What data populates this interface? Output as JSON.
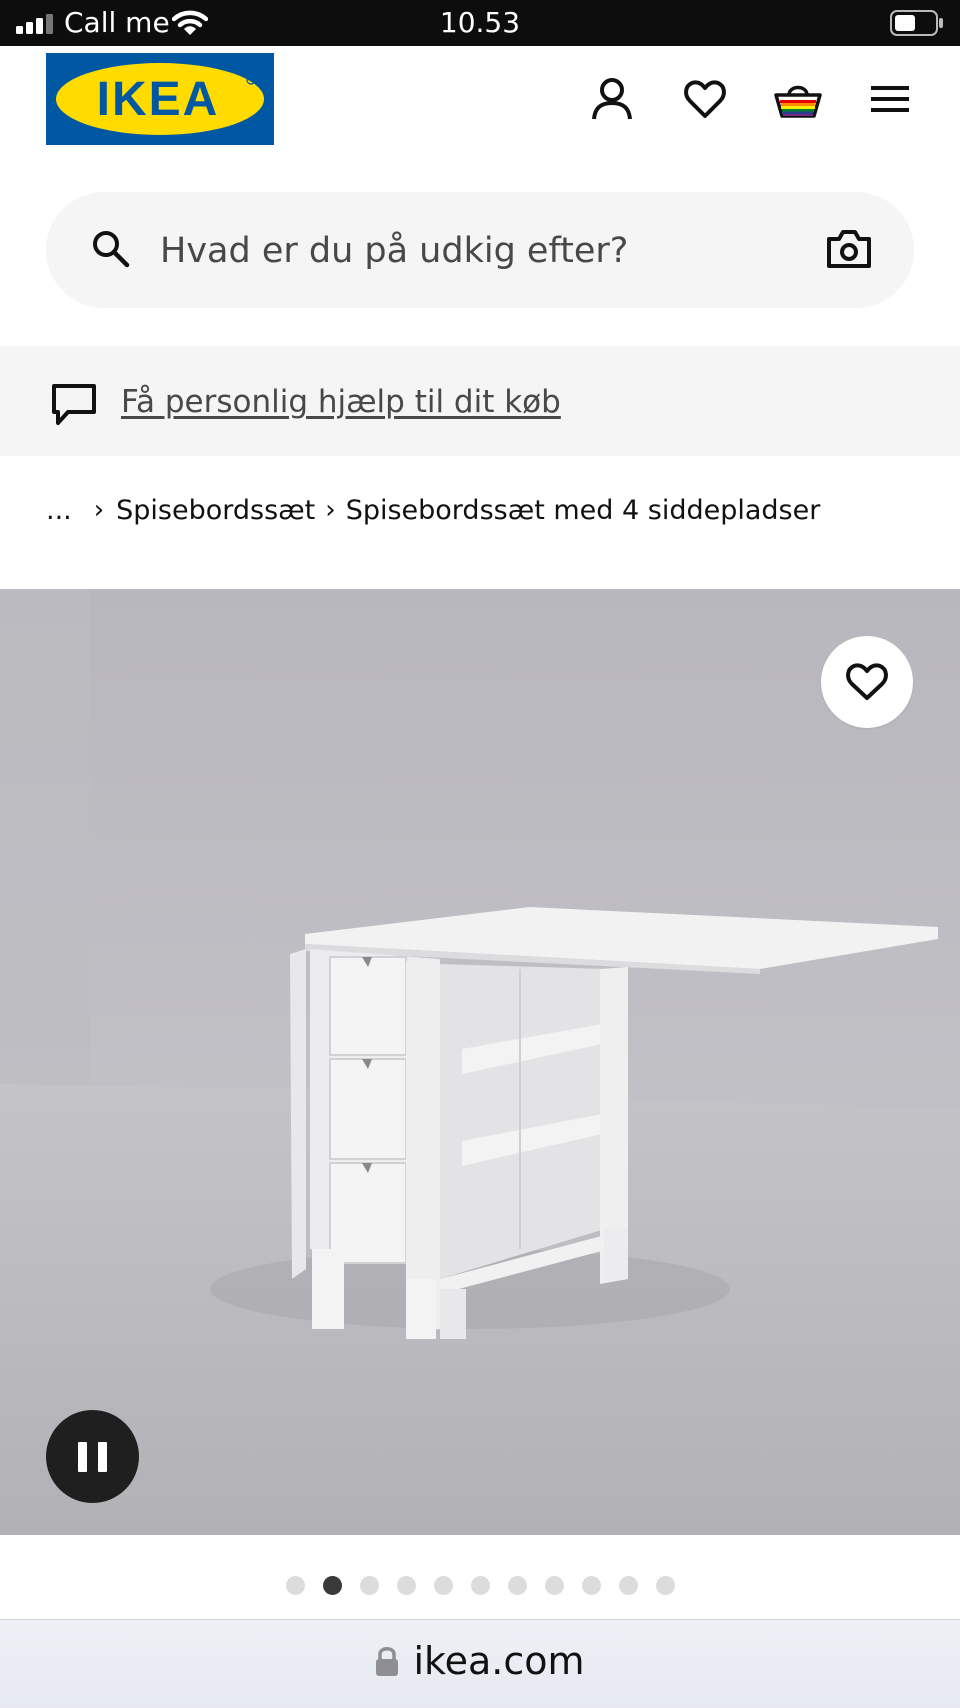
{
  "status_bar": {
    "carrier": "Call me",
    "time": "10.53"
  },
  "header": {
    "logo_text": "IKEA",
    "icons": [
      "account-icon",
      "heart-icon",
      "basket-icon",
      "menu-icon"
    ]
  },
  "search": {
    "placeholder": "Hvad er du på udkig efter?",
    "value": ""
  },
  "help_banner": {
    "link_text": "Få personlig hjælp til dit køb"
  },
  "breadcrumb": {
    "ellipsis": "...",
    "items": [
      "Spisebordssæt",
      "Spisebordssæt med 4 siddepladser"
    ]
  },
  "gallery": {
    "total_images": 11,
    "active_index": 1
  },
  "url_bar": {
    "domain": "ikea.com"
  },
  "colors": {
    "ikea_blue": "#0058a3",
    "ikea_yellow": "#ffdb00",
    "status_bar_bg": "#0d0d0d",
    "banner_bg": "#f5f5f5"
  }
}
